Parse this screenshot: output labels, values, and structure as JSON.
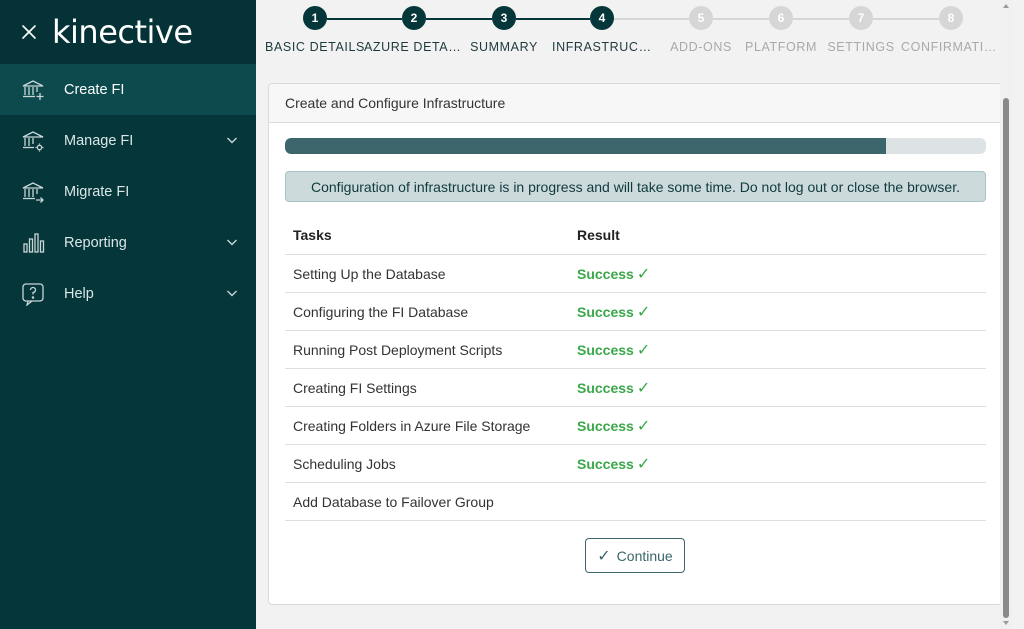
{
  "brand": {
    "logo_text": "kinective"
  },
  "sidebar": {
    "items": [
      {
        "label": "Create FI",
        "icon": "bank-plus-icon",
        "active": true,
        "has_children": false
      },
      {
        "label": "Manage FI",
        "icon": "bank-gear-icon",
        "active": false,
        "has_children": true
      },
      {
        "label": "Migrate FI",
        "icon": "bank-arrow-icon",
        "active": false,
        "has_children": false
      },
      {
        "label": "Reporting",
        "icon": "bar-chart-icon",
        "active": false,
        "has_children": true
      },
      {
        "label": "Help",
        "icon": "help-bubble-icon",
        "active": false,
        "has_children": true
      }
    ]
  },
  "stepper": {
    "steps": [
      {
        "number": "1",
        "label": "BASIC DETAILS",
        "state": "done"
      },
      {
        "number": "2",
        "label": "AZURE DETAILS",
        "state": "done"
      },
      {
        "number": "3",
        "label": "SUMMARY",
        "state": "done"
      },
      {
        "number": "4",
        "label": "INFRASTRUCTURE",
        "state": "done"
      },
      {
        "number": "5",
        "label": "ADD-ONS",
        "state": "todo"
      },
      {
        "number": "6",
        "label": "PLATFORM",
        "state": "todo"
      },
      {
        "number": "7",
        "label": "SETTINGS",
        "state": "todo"
      },
      {
        "number": "8",
        "label": "CONFIRMATION",
        "state": "todo"
      }
    ]
  },
  "card": {
    "title": "Create and Configure Infrastructure",
    "progress_fraction": 0.858,
    "alert_text": "Configuration of infrastructure is in progress and will take some time. Do not log out or close the browser.",
    "columns": {
      "task": "Tasks",
      "result": "Result"
    },
    "rows": [
      {
        "task": "Setting Up the Database",
        "result": "Success"
      },
      {
        "task": "Configuring the FI Database",
        "result": "Success"
      },
      {
        "task": "Running Post Deployment Scripts",
        "result": "Success"
      },
      {
        "task": "Creating FI Settings",
        "result": "Success"
      },
      {
        "task": "Creating Folders in Azure File Storage",
        "result": "Success"
      },
      {
        "task": "Scheduling Jobs",
        "result": "Success"
      },
      {
        "task": "Add Database to Failover Group",
        "result": ""
      }
    ],
    "check_glyph": "✓",
    "continue_label": "Continue"
  },
  "colors": {
    "sidebar_bg": "#04363a",
    "accent": "#3c666b",
    "success": "#3aa84a"
  }
}
